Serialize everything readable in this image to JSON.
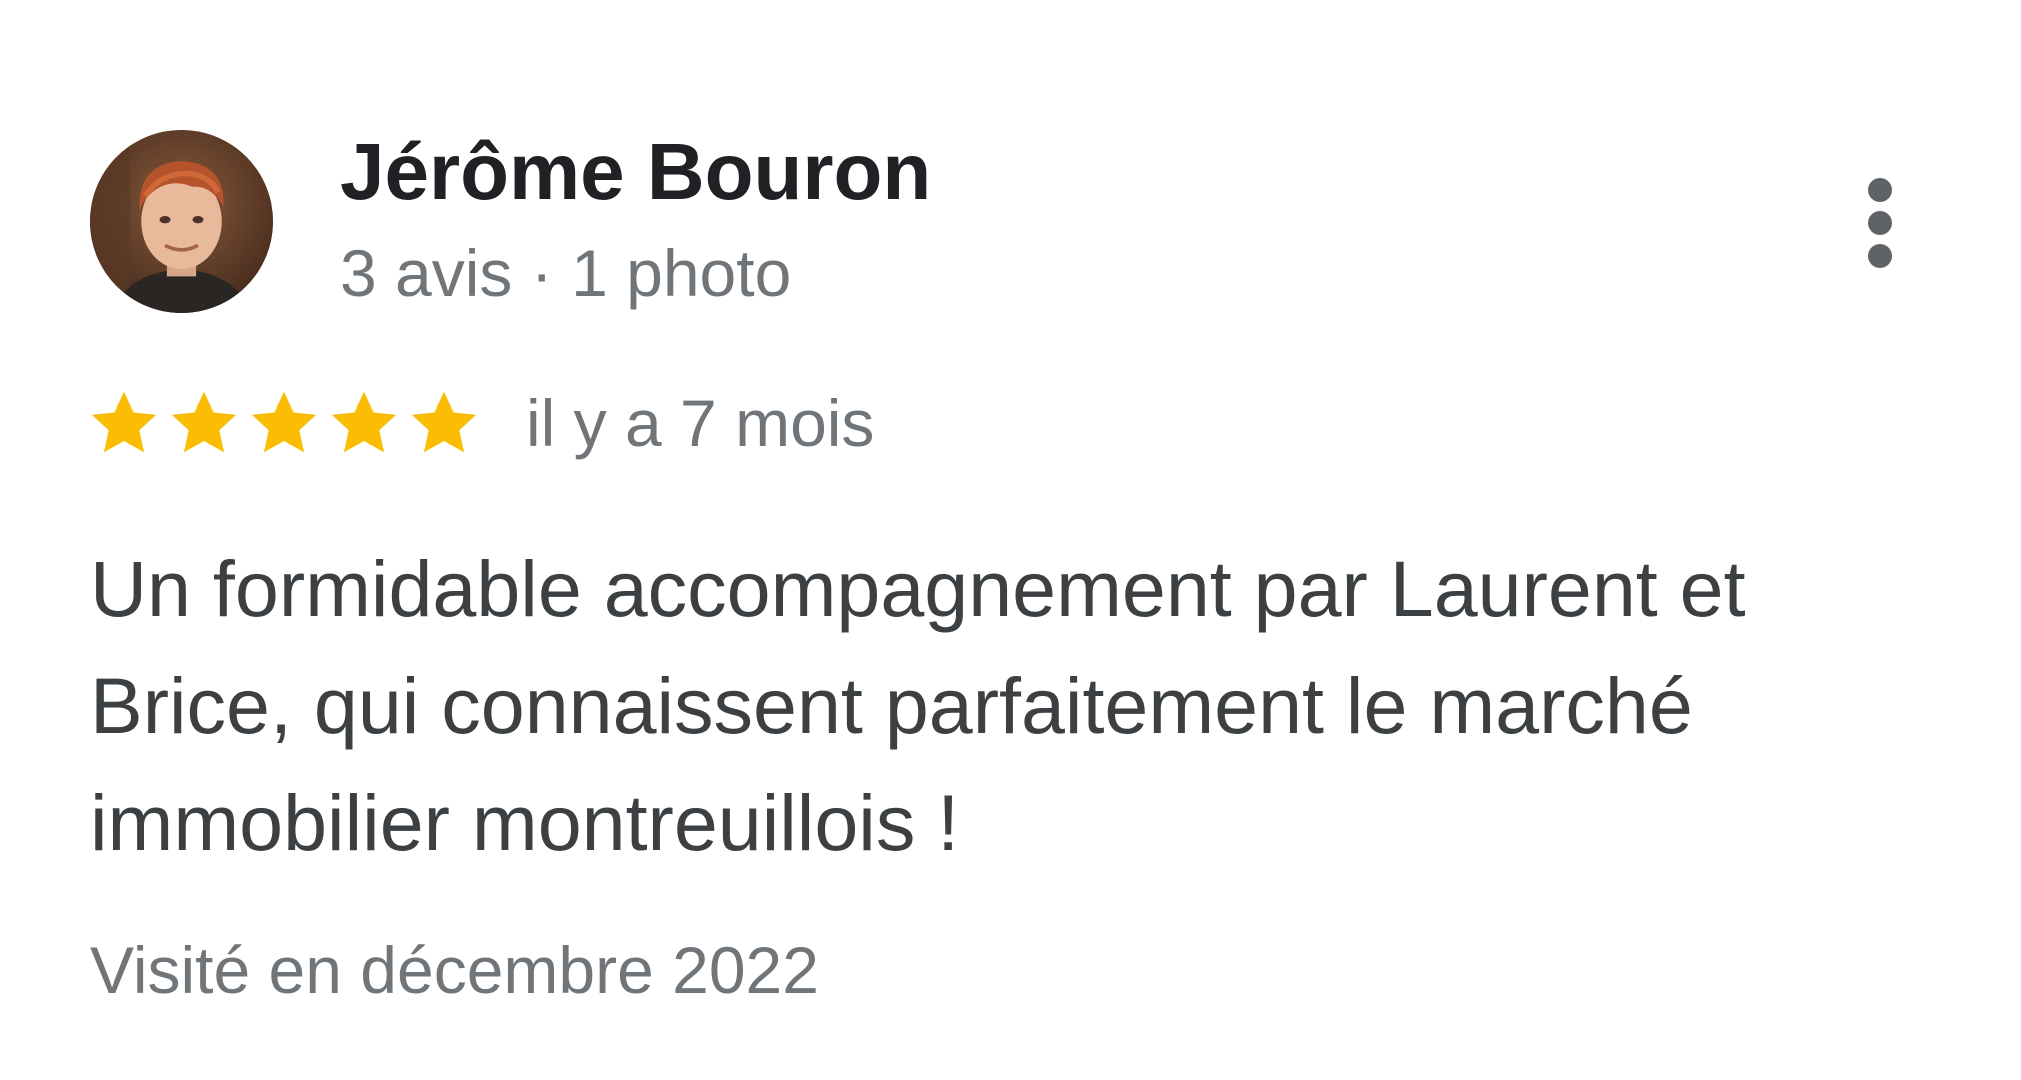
{
  "review": {
    "reviewer": {
      "name": "Jérôme Bouron",
      "meta": "3 avis · 1 photo",
      "avatar_icon": "person-photo"
    },
    "more_menu_icon": "more-vert-icon",
    "rating": {
      "stars": 5,
      "max_stars": 5,
      "star_color": "#fbbc04"
    },
    "date": "il y a 7 mois",
    "text": "Un formidable accompagnement par Laurent et Brice, qui connaissent parfaitement le marché immobilier montreuillois !",
    "visit": "Visité en décembre 2022"
  },
  "colors": {
    "name": "#202124",
    "secondary_text": "#70757a",
    "body_text": "#3c4043",
    "icon": "#5f6368"
  }
}
